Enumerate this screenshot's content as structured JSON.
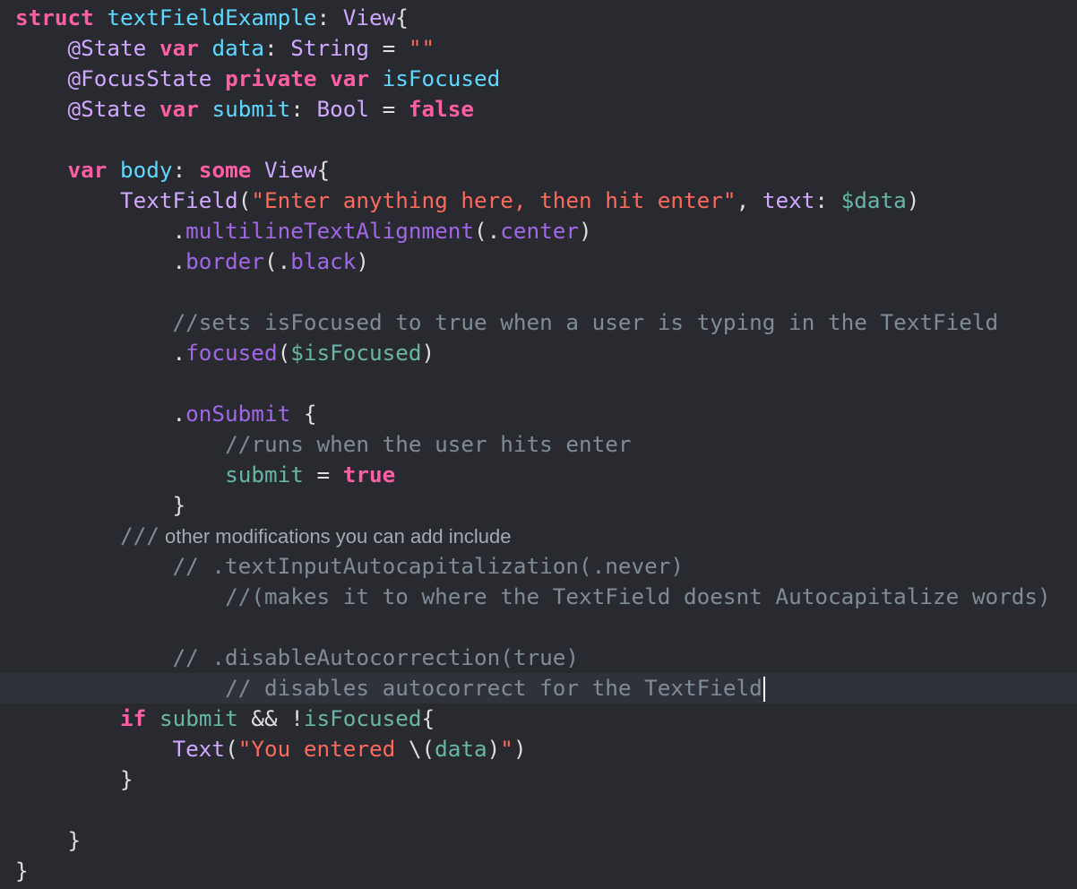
{
  "editor": {
    "theme_colors": {
      "background": "#292a30",
      "current_line": "#2f3239",
      "plain": "#dfdfe0",
      "keyword": "#fc5fa3",
      "type_decl": "#5dd8ff",
      "other_type": "#d0a8ff",
      "func_member": "#a167e6",
      "property": "#67b7a4",
      "string": "#fc6a5d",
      "comment": "#7f8c98",
      "doc_comment": "#a2aab2"
    },
    "active_line_index": 22,
    "lines": [
      {
        "tokens": [
          {
            "t": "struct",
            "c": "kw"
          },
          {
            "t": " "
          },
          {
            "t": "textFieldExample",
            "c": "decl"
          },
          {
            "t": ": "
          },
          {
            "t": "View",
            "c": "type"
          },
          {
            "t": "{"
          }
        ]
      },
      {
        "tokens": [
          {
            "t": "    "
          },
          {
            "t": "@State",
            "c": "attr"
          },
          {
            "t": " "
          },
          {
            "t": "var",
            "c": "kw"
          },
          {
            "t": " "
          },
          {
            "t": "data",
            "c": "decl"
          },
          {
            "t": ": "
          },
          {
            "t": "String",
            "c": "type"
          },
          {
            "t": " = "
          },
          {
            "t": "\"\"",
            "c": "str"
          }
        ]
      },
      {
        "tokens": [
          {
            "t": "    "
          },
          {
            "t": "@FocusState",
            "c": "attr"
          },
          {
            "t": " "
          },
          {
            "t": "private",
            "c": "kw"
          },
          {
            "t": " "
          },
          {
            "t": "var",
            "c": "kw"
          },
          {
            "t": " "
          },
          {
            "t": "isFocused",
            "c": "decl"
          }
        ]
      },
      {
        "tokens": [
          {
            "t": "    "
          },
          {
            "t": "@State",
            "c": "attr"
          },
          {
            "t": " "
          },
          {
            "t": "var",
            "c": "kw"
          },
          {
            "t": " "
          },
          {
            "t": "submit",
            "c": "decl"
          },
          {
            "t": ": "
          },
          {
            "t": "Bool",
            "c": "type"
          },
          {
            "t": " = "
          },
          {
            "t": "false",
            "c": "kw"
          }
        ]
      },
      {
        "tokens": []
      },
      {
        "tokens": [
          {
            "t": "    "
          },
          {
            "t": "var",
            "c": "kw"
          },
          {
            "t": " "
          },
          {
            "t": "body",
            "c": "decl"
          },
          {
            "t": ": "
          },
          {
            "t": "some",
            "c": "kw"
          },
          {
            "t": " "
          },
          {
            "t": "View",
            "c": "type"
          },
          {
            "t": "{"
          }
        ]
      },
      {
        "tokens": [
          {
            "t": "        "
          },
          {
            "t": "TextField",
            "c": "type"
          },
          {
            "t": "("
          },
          {
            "t": "\"Enter anything here, then hit enter\"",
            "c": "str"
          },
          {
            "t": ", "
          },
          {
            "t": "text",
            "c": "type"
          },
          {
            "t": ": "
          },
          {
            "t": "$data",
            "c": "prop"
          },
          {
            "t": ")"
          }
        ]
      },
      {
        "tokens": [
          {
            "t": "            ."
          },
          {
            "t": "multilineTextAlignment",
            "c": "func"
          },
          {
            "t": "(."
          },
          {
            "t": "center",
            "c": "func"
          },
          {
            "t": ")"
          }
        ]
      },
      {
        "tokens": [
          {
            "t": "            ."
          },
          {
            "t": "border",
            "c": "func"
          },
          {
            "t": "(."
          },
          {
            "t": "black",
            "c": "func"
          },
          {
            "t": ")"
          }
        ]
      },
      {
        "tokens": []
      },
      {
        "tokens": [
          {
            "t": "            "
          },
          {
            "t": "//sets isFocused to true when a user is typing in the TextField",
            "c": "com"
          }
        ]
      },
      {
        "tokens": [
          {
            "t": "            ."
          },
          {
            "t": "focused",
            "c": "func"
          },
          {
            "t": "("
          },
          {
            "t": "$isFocused",
            "c": "prop"
          },
          {
            "t": ")"
          }
        ]
      },
      {
        "tokens": []
      },
      {
        "tokens": [
          {
            "t": "            ."
          },
          {
            "t": "onSubmit",
            "c": "func"
          },
          {
            "t": " {"
          }
        ]
      },
      {
        "tokens": [
          {
            "t": "                "
          },
          {
            "t": "//runs when the user hits enter",
            "c": "com"
          }
        ]
      },
      {
        "tokens": [
          {
            "t": "                "
          },
          {
            "t": "submit",
            "c": "prop"
          },
          {
            "t": " = "
          },
          {
            "t": "true",
            "c": "kw"
          }
        ]
      },
      {
        "tokens": [
          {
            "t": "            }"
          }
        ]
      },
      {
        "tokens": [
          {
            "t": "        "
          },
          {
            "t": "///",
            "c": "com"
          },
          {
            "t": " other modifications you can add include",
            "c": "doc"
          }
        ]
      },
      {
        "tokens": [
          {
            "t": "            "
          },
          {
            "t": "// .textInputAutocapitalization(.never)",
            "c": "com"
          }
        ]
      },
      {
        "tokens": [
          {
            "t": "                "
          },
          {
            "t": "//(makes it to where the TextField doesnt Autocapitalize words)",
            "c": "com"
          }
        ]
      },
      {
        "tokens": []
      },
      {
        "tokens": [
          {
            "t": "            "
          },
          {
            "t": "// .disableAutocorrection(true)",
            "c": "com"
          }
        ]
      },
      {
        "tokens": [
          {
            "t": "                "
          },
          {
            "t": "// disables autocorrect for the TextField",
            "c": "com"
          }
        ]
      },
      {
        "tokens": [
          {
            "t": "        "
          },
          {
            "t": "if",
            "c": "kw"
          },
          {
            "t": " "
          },
          {
            "t": "submit",
            "c": "prop"
          },
          {
            "t": " && !"
          },
          {
            "t": "isFocused",
            "c": "prop"
          },
          {
            "t": "{"
          }
        ]
      },
      {
        "tokens": [
          {
            "t": "            "
          },
          {
            "t": "Text",
            "c": "type"
          },
          {
            "t": "("
          },
          {
            "t": "\"You entered ",
            "c": "str"
          },
          {
            "t": "\\("
          },
          {
            "t": "data",
            "c": "prop"
          },
          {
            "t": ")"
          },
          {
            "t": "\"",
            "c": "str"
          },
          {
            "t": ")"
          }
        ]
      },
      {
        "tokens": [
          {
            "t": "        }"
          }
        ]
      },
      {
        "tokens": []
      },
      {
        "tokens": [
          {
            "t": "    }"
          }
        ]
      },
      {
        "tokens": [
          {
            "t": "}"
          }
        ]
      }
    ]
  }
}
